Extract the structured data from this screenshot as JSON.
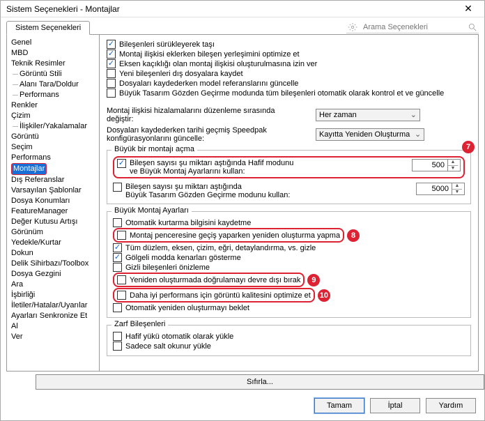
{
  "window": {
    "title": "Sistem Seçenekleri - Montajlar"
  },
  "tab": {
    "label": "Sistem Seçenekleri"
  },
  "search": {
    "placeholder": "Arama Seçenekleri"
  },
  "sidebar": {
    "items": [
      "Genel",
      "MBD",
      "Teknik Resimler",
      "Görüntü Stili",
      "Alanı Tara/Doldur",
      "Performans",
      "Renkler",
      "Çizim",
      "İlişkiler/Yakalamalar",
      "Görüntü",
      "Seçim",
      "Performans",
      "Montajlar",
      "Dış Referanslar",
      "Varsayılan Şablonlar",
      "Dosya Konumları",
      "FeatureManager",
      "Değer Kutusu Artışı",
      "Görünüm",
      "Yedekle/Kurtar",
      "Dokun",
      "Delik Sihirbazı/Toolbox",
      "Dosya Gezgini",
      "Ara",
      "İşbirliği",
      "İletiler/Hatalar/Uyarılar",
      "Ayarları Senkronize Et",
      "Al",
      "Ver"
    ],
    "childIdx": [
      3,
      4,
      5,
      8
    ],
    "selectedIdx": 12
  },
  "top_checks": [
    {
      "label": "Bileşenleri sürükleyerek taşı",
      "checked": true
    },
    {
      "label": "Montaj ilişkisi eklerken bileşen yerleşimini optimize et",
      "checked": true
    },
    {
      "label": "Eksen kaçıklığı olan montaj ilişkisi oluşturulmasına izin ver",
      "checked": true
    },
    {
      "label": "Yeni bileşenleri dış dosyalara kaydet",
      "checked": false
    },
    {
      "label": "Dosyaları kaydederken model referanslarını güncelle",
      "checked": false
    },
    {
      "label": "Büyük Tasarım Gözden Geçirme modunda tüm bileşenleri otomatik olarak kontrol et ve güncelle",
      "checked": false
    }
  ],
  "mid": {
    "row1_label": "Montaj ilişkisi hizalamalarını düzenleme sırasında değiştir:",
    "row1_value": "Her zaman",
    "row2_label": "Dosyaları kaydederken tarihi geçmiş Speedpak konfigürasyonlarını güncelle:",
    "row2_value": "Kayıtta Yeniden Oluşturma"
  },
  "grp_open": {
    "legend": "Büyük bir montajı açma",
    "r1a": "Bileşen sayısı şu miktarı aştığında Hafif modunu",
    "r1b": "ve Büyük Montaj Ayarlarını kullan:",
    "r1_checked": true,
    "r1_val": "500",
    "r2a": "Bileşen sayısı şu miktarı aştığında",
    "r2b": "Büyük Tasarım Gözden Geçirme modunu kullan:",
    "r2_checked": false,
    "r2_val": "5000"
  },
  "grp_big": {
    "legend": "Büyük Montaj Ayarları",
    "items": [
      {
        "label": "Otomatik kurtarma bilgisini kaydetme",
        "checked": false
      },
      {
        "label": "Montaj penceresine geçiş yaparken yeniden oluşturma yapma",
        "checked": false,
        "callout": 8
      },
      {
        "label": "Tüm düzlem, eksen, çizim, eğri, detaylandırma, vs. gizle",
        "checked": true
      },
      {
        "label": "Gölgeli modda kenarları gösterme",
        "checked": true
      },
      {
        "label": "Gizli bileşenleri önizleme",
        "checked": false
      },
      {
        "label": "Yeniden oluşturmada doğrulamayı devre dışı bırak",
        "checked": false,
        "callout": 9
      },
      {
        "label": "Daha iyi performans için görüntü kalitesini optimize et",
        "checked": false,
        "callout": 10
      },
      {
        "label": "Otomatik yeniden oluşturmayı beklet",
        "checked": false
      }
    ]
  },
  "grp_env": {
    "legend": "Zarf Bileşenleri",
    "items": [
      {
        "label": "Hafif yükü otomatik olarak yükle",
        "checked": false
      },
      {
        "label": "Sadece salt okunur yükle",
        "checked": false
      }
    ]
  },
  "callouts": {
    "seven": "7",
    "eight": "8",
    "nine": "9",
    "ten": "10"
  },
  "buttons": {
    "reset": "Sıfırla...",
    "ok": "Tamam",
    "cancel": "İptal",
    "help": "Yardım"
  }
}
